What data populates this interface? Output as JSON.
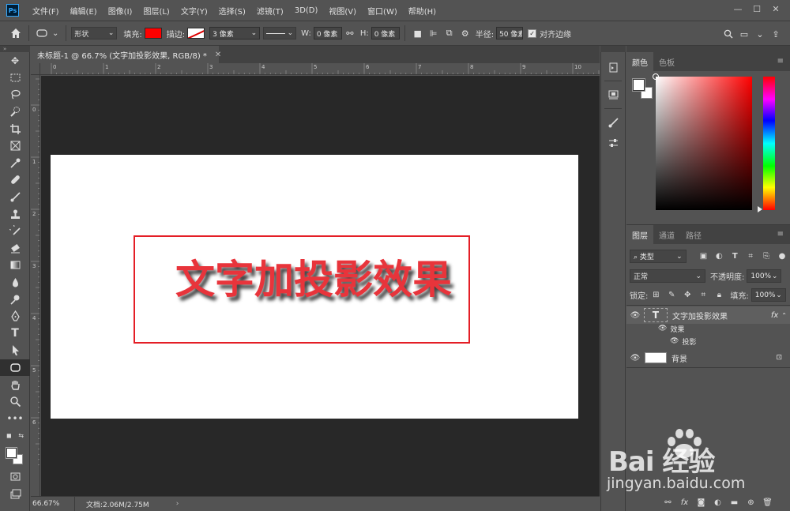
{
  "app": {
    "logo": "Ps"
  },
  "menu": [
    "文件(F)",
    "编辑(E)",
    "图像(I)",
    "图层(L)",
    "文字(Y)",
    "选择(S)",
    "滤镜(T)",
    "3D(D)",
    "视图(V)",
    "窗口(W)",
    "帮助(H)"
  ],
  "options": {
    "mode": "形状",
    "fill_label": "填充:",
    "fill_color": "#ff0000",
    "stroke_label": "描边:",
    "stroke_width": "3 像素",
    "w_label": "W:",
    "w_value": "0 像素",
    "h_label": "H:",
    "h_value": "0 像素",
    "radius_label": "半径:",
    "radius_value": "50 像素",
    "align_edges": "对齐边缘"
  },
  "document": {
    "tab_title": "未标题-1 @ 66.7% (文字加投影效果, RGB/8) *",
    "art_text": "文字加投影效果",
    "text_color": "#e8343b",
    "frame_color": "#e41e26"
  },
  "rulers": {
    "top": [
      "0",
      "1",
      "2",
      "3",
      "4",
      "5",
      "6",
      "7",
      "8",
      "9",
      "10"
    ],
    "left": [
      "1",
      "0",
      "1",
      "2",
      "3",
      "4",
      "5",
      "6"
    ]
  },
  "status": {
    "zoom": "66.67%",
    "doc_info": "文档:2.06M/2.75M",
    "arrow": "›"
  },
  "color_panel": {
    "tabs": [
      "颜色",
      "色板"
    ]
  },
  "layers_panel": {
    "tabs": [
      "图层",
      "通道",
      "路径"
    ],
    "filter": "类型",
    "blend_mode": "正常",
    "opacity_label": "不透明度:",
    "opacity_value": "100%",
    "lock_label": "锁定:",
    "fill_label": "填充:",
    "fill_value": "100%",
    "layers": [
      {
        "name": "文字加投影效果",
        "fx": "fx",
        "effects_label": "效果",
        "effect": "投影"
      },
      {
        "name": "背景"
      }
    ]
  },
  "watermark": {
    "brand": "Bai 经验",
    "url": "jingyan.baidu.com"
  }
}
